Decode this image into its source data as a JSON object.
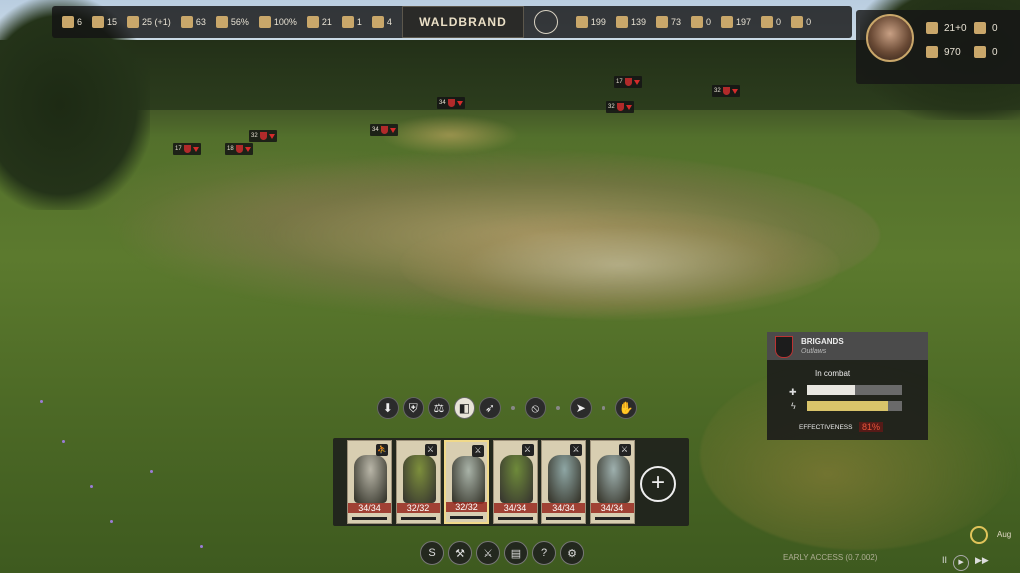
{
  "topbar": {
    "left_resources": [
      {
        "icon": "meat-icon",
        "value": "6"
      },
      {
        "icon": "chicken-icon",
        "value": "15"
      },
      {
        "icon": "house-icon",
        "value": "25 (+1)"
      },
      {
        "icon": "population-icon",
        "value": "63"
      },
      {
        "icon": "approval-icon",
        "value": "56%"
      },
      {
        "icon": "workforce-icon",
        "value": "100%"
      },
      {
        "icon": "worker-icon",
        "value": "21"
      },
      {
        "icon": "horseshoe-icon",
        "value": "1"
      },
      {
        "icon": "family-icon",
        "value": "4"
      }
    ],
    "region_name": "WALDBRAND",
    "right_resources": [
      {
        "icon": "tools-icon",
        "value": "199"
      },
      {
        "icon": "planks-icon",
        "value": "139"
      },
      {
        "icon": "clay-icon",
        "value": "73"
      },
      {
        "icon": "grain-icon",
        "value": "0"
      },
      {
        "icon": "firewood-icon",
        "value": "197"
      },
      {
        "icon": "iron-icon",
        "value": "0"
      },
      {
        "icon": "candle-icon",
        "value": "0"
      }
    ]
  },
  "lord": {
    "stats": [
      {
        "icon": "treasury-icon",
        "value": "21+0"
      },
      {
        "icon": "influence-icon",
        "value": "0"
      },
      {
        "icon": "weapons-icon",
        "value": "970"
      },
      {
        "icon": "renown-icon",
        "value": "0"
      }
    ]
  },
  "unit_tags": [
    {
      "value": "34"
    },
    {
      "value": "34"
    },
    {
      "value": "32"
    },
    {
      "value": "17"
    },
    {
      "value": "18"
    },
    {
      "value": "32"
    },
    {
      "value": "17"
    },
    {
      "value": "32"
    }
  ],
  "stances": [
    {
      "icon": "hold-ground-icon"
    },
    {
      "icon": "shield-wall-icon"
    },
    {
      "icon": "balanced-icon"
    },
    {
      "icon": "defensive-icon"
    },
    {
      "icon": "charge-icon"
    }
  ],
  "stance_actions": [
    {
      "icon": "stop-icon"
    },
    {
      "icon": "run-icon"
    },
    {
      "icon": "retreat-icon"
    }
  ],
  "squads": [
    {
      "label": "34/34",
      "color": "#b9b6a8",
      "icon": "walk-icon"
    },
    {
      "label": "32/32",
      "color": "#7d8f3c",
      "icon": "swords-icon"
    },
    {
      "label": "32/32",
      "color": "#a9b3a8",
      "icon": "swords-icon"
    },
    {
      "label": "34/34",
      "color": "#6e8a3a",
      "icon": "swords-icon"
    },
    {
      "label": "34/34",
      "color": "#8ea6a4",
      "icon": "swords-icon"
    },
    {
      "label": "34/34",
      "color": "#9eb0ae",
      "icon": "swords-icon"
    }
  ],
  "add_squad_label": "+",
  "bottom_buttons": [
    {
      "icon": "road-icon"
    },
    {
      "icon": "build-icon"
    },
    {
      "icon": "army-icon"
    },
    {
      "icon": "ledger-icon"
    },
    {
      "icon": "help-icon"
    },
    {
      "icon": "settings-icon"
    }
  ],
  "enemy_panel": {
    "name": "BRIGANDS",
    "subtitle": "Outlaws",
    "status": "In combat",
    "health_fraction": 0.5,
    "morale_fraction": 0.85,
    "effectiveness_label": "EFFECTIVENESS",
    "effectiveness_value": "81%"
  },
  "footer": {
    "version": "EARLY ACCESS (0.7.002)",
    "month": "Aug",
    "speed_controls": [
      "II",
      "▶",
      "▶▶"
    ]
  },
  "colors": {
    "accent_gold": "#c9a76a",
    "enemy_red": "#b12a2a",
    "health_white": "#e8e6e0",
    "morale_yellow": "#d9c46a"
  }
}
